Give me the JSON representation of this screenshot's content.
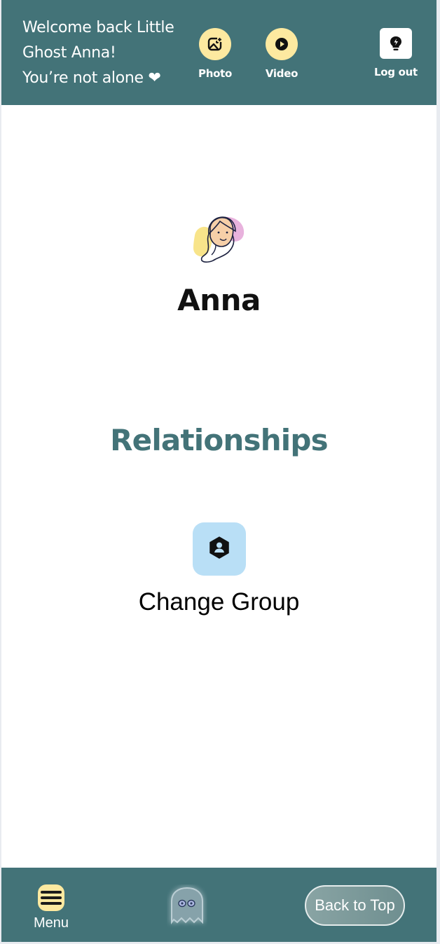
{
  "header": {
    "welcome_lines": [
      "Welcome back Little",
      "Ghost Anna!",
      "You’re not alone ❤"
    ],
    "photo_label": "Photo",
    "video_label": "Video",
    "logout_label": "Log out",
    "photo_icon": "image-icon",
    "video_icon": "play-icon",
    "logout_icon": "lightbulb-icon"
  },
  "profile": {
    "name": "Anna",
    "avatar": "girl-avatar-illustration"
  },
  "relationships": {
    "title": "Relationships",
    "change_group_label": "Change Group",
    "change_group_icon": "user-hexagon-icon"
  },
  "footer": {
    "menu_label": "Menu",
    "menu_icon": "hamburger-icon",
    "ghost_icon": "ghost-icon",
    "back_to_top_label": "Back to Top"
  },
  "colors": {
    "primary": "#437378",
    "accent_yellow": "#fde9a0",
    "tile_blue": "#b9dff6"
  }
}
